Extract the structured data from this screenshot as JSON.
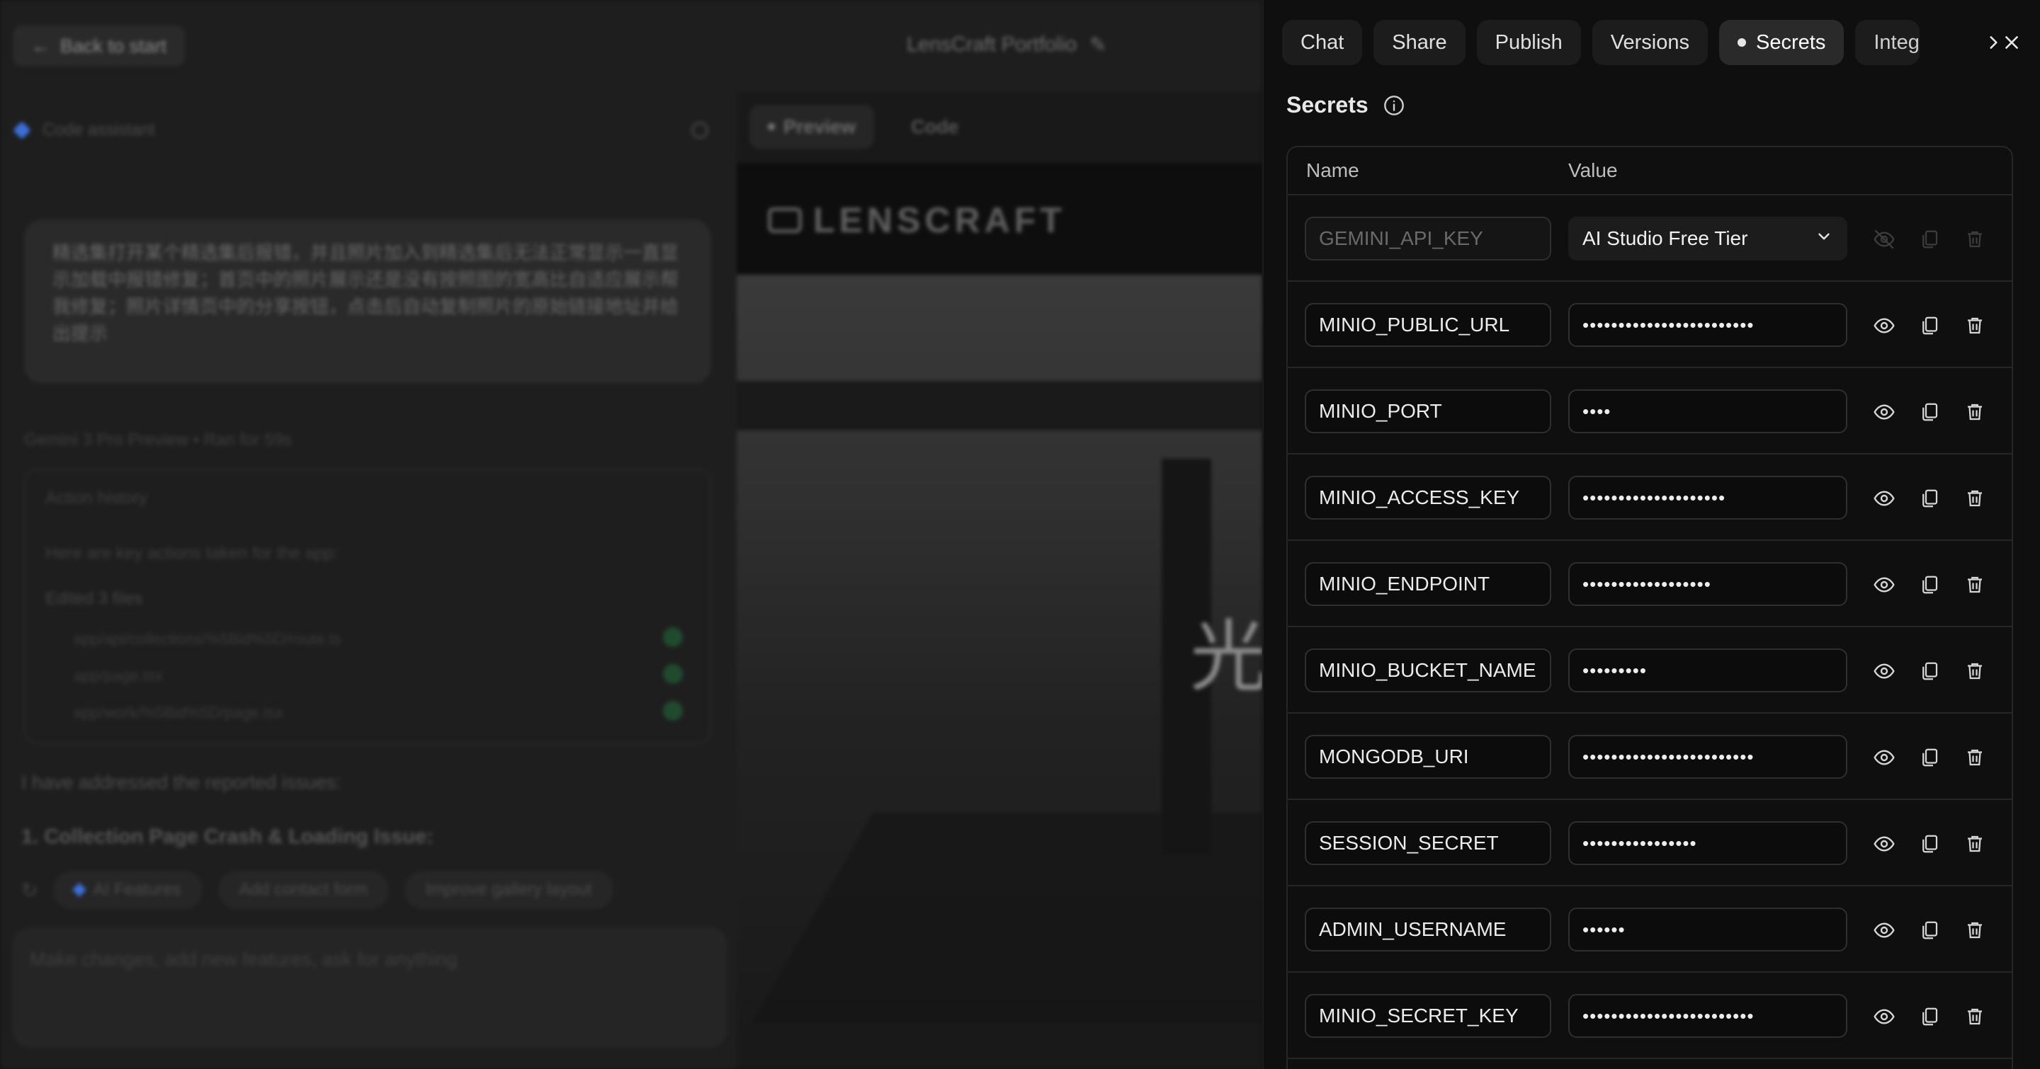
{
  "background": {
    "back_button": "Back to start",
    "project_title": "LensCraft Portfolio",
    "assistant_label": "Code assistant",
    "user_message": "精选集打开某个精选集后报错，并且照片加入到精选集后无法正常显示一直显示加载中报错修复；首页中的照片展示还是没有按照图的宽高比自适应展示帮我修复；照片详情页中的分享按钮，点击后自动复制照片的原始链接地址并给出提示",
    "model_line": "Gemini 3 Pro Preview  •  Ran for 59s",
    "history_title": "Action history",
    "history_sub": "Here are key actions taken for the app:",
    "history_edit": "Edited 3 files",
    "history_files": [
      "app/api/collections/%5Bid%5D/route.ts",
      "app/page.tsx",
      "app/work/%5Bid%5D/page.tsx"
    ],
    "addressed": "I have addressed the reported issues:",
    "crash_heading": "1. Collection Page Crash & Loading Issue:",
    "chips": [
      "AI Features",
      "Add contact form",
      "Improve gallery layout"
    ],
    "prompt_placeholder": "Make changes, add new features, ask for anything",
    "preview_tabs": [
      "Preview",
      "Code"
    ],
    "site_logo": "LENSCRAFT",
    "hero_glyph": "光"
  },
  "panel": {
    "tabs": [
      "Chat",
      "Share",
      "Publish",
      "Versions",
      "Secrets",
      "Integ"
    ],
    "active_tab": "Secrets",
    "section_title": "Secrets",
    "columns": {
      "name": "Name",
      "value": "Value"
    },
    "rows": [
      {
        "name": "GEMINI_API_KEY",
        "value": "AI Studio Free Tier",
        "type": "select",
        "disabled": true
      },
      {
        "name": "MINIO_PUBLIC_URL",
        "value": "••••••••••••••••••••••••",
        "type": "masked"
      },
      {
        "name": "MINIO_PORT",
        "value": "••••",
        "type": "masked"
      },
      {
        "name": "MINIO_ACCESS_KEY",
        "value": "••••••••••••••••••••",
        "type": "masked"
      },
      {
        "name": "MINIO_ENDPOINT",
        "value": "••••••••••••••••••",
        "type": "masked"
      },
      {
        "name": "MINIO_BUCKET_NAME",
        "value": "•••••••••",
        "type": "masked"
      },
      {
        "name": "MONGODB_URI",
        "value": "••••••••••••••••••••••••",
        "type": "masked"
      },
      {
        "name": "SESSION_SECRET",
        "value": "••••••••••••••••",
        "type": "masked"
      },
      {
        "name": "ADMIN_USERNAME",
        "value": "••••••",
        "type": "masked"
      },
      {
        "name": "MINIO_SECRET_KEY",
        "value": "••••••••••••••••••••••••",
        "type": "masked"
      }
    ]
  }
}
